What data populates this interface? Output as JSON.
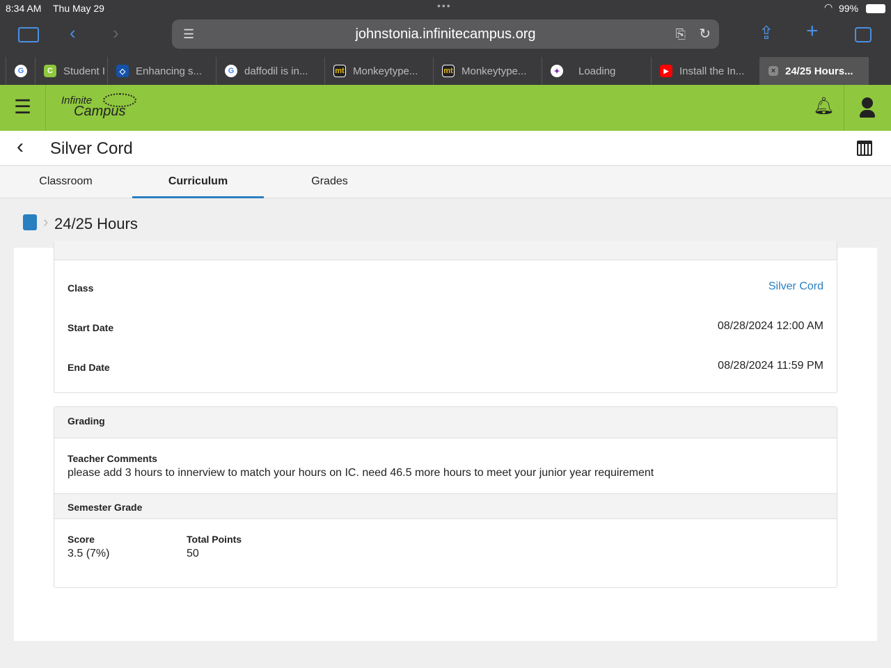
{
  "status": {
    "time": "8:34 AM",
    "date": "Thu May 29",
    "battery": "99%"
  },
  "browser": {
    "url": "johnstonia.infinitecampus.org"
  },
  "tabs": [
    {
      "label": "Student I",
      "icon": "C",
      "color": "#8fc73e"
    },
    {
      "label": "Enhancing s...",
      "icon": "◇",
      "color": "#1352a8"
    },
    {
      "label": "daffodil is in...",
      "icon": "G",
      "color": "#ffffff"
    },
    {
      "label": "Monkeytype...",
      "icon": "mt",
      "color": "#222222"
    },
    {
      "label": "Monkeytype...",
      "icon": "mt",
      "color": "#222222"
    },
    {
      "label": "Loading",
      "icon": "✦",
      "color": "#ffffff"
    },
    {
      "label": "Install the In...",
      "icon": "▶",
      "color": "#ff0000"
    },
    {
      "label": "24/25 Hours...",
      "icon": "×",
      "color": "#888888"
    }
  ],
  "app": {
    "logo_line1": "Infinite",
    "logo_line2": "Campus",
    "title": "Silver Cord"
  },
  "subtabs": [
    "Classroom",
    "Curriculum",
    "Grades"
  ],
  "breadcrumb": "24/25 Hours",
  "details": [
    {
      "label": "Class",
      "value": "Silver Cord"
    },
    {
      "label": "Start Date",
      "value": "08/28/2024 12:00 AM"
    },
    {
      "label": "End Date",
      "value": "08/28/2024 11:59 PM"
    }
  ],
  "grading": {
    "header": "Grading",
    "comments_label": "Teacher Comments",
    "comments": "please add 3 hours to innerview to match your hours on IC. need 46.5 more hours to meet your junior year requirement",
    "semester_header": "Semester Grade",
    "score_label": "Score",
    "score": "3.5 (7%)",
    "total_label": "Total Points",
    "total": "50"
  }
}
